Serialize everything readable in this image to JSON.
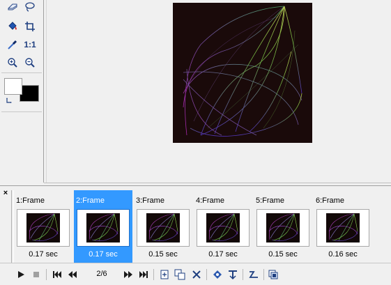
{
  "toolbox": {
    "tools": [
      {
        "name": "eraser-icon"
      },
      {
        "name": "lasso-icon"
      },
      {
        "name": "paint-bucket-icon"
      },
      {
        "name": "crop-icon"
      },
      {
        "name": "eyedropper-icon"
      },
      {
        "name": "actual-size-label",
        "text": "1:1"
      },
      {
        "name": "zoom-in-icon"
      },
      {
        "name": "zoom-out-icon"
      }
    ],
    "foreground_color": "#ffffff",
    "background_color": "#000000"
  },
  "animation": {
    "selected_index": 1,
    "frames": [
      {
        "label": "1:Frame",
        "delay": "0.17 sec"
      },
      {
        "label": "2:Frame",
        "delay": "0.17 sec"
      },
      {
        "label": "3:Frame",
        "delay": "0.15 sec"
      },
      {
        "label": "4:Frame",
        "delay": "0.17 sec"
      },
      {
        "label": "5:Frame",
        "delay": "0.15 sec"
      },
      {
        "label": "6:Frame",
        "delay": "0.16 sec"
      }
    ],
    "frame_counter": "2/6"
  },
  "colors": {
    "selection": "#3399ff",
    "canvas_bg": "#1a0a0a"
  }
}
